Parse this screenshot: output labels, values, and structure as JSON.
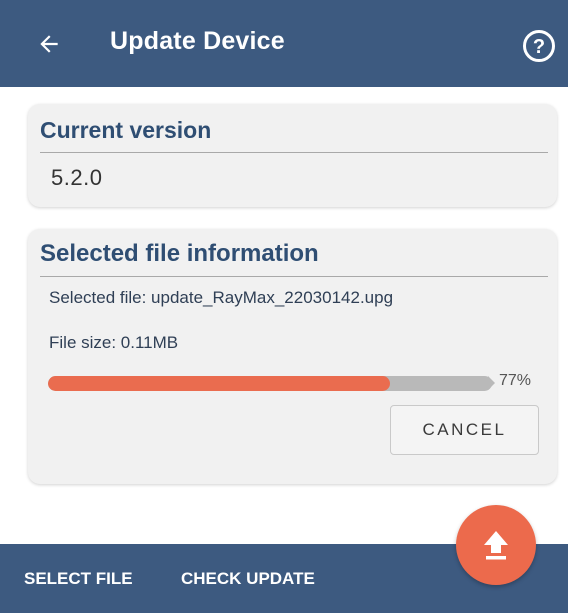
{
  "header": {
    "title": "Update Device",
    "back_icon": "arrow-left-icon",
    "help_icon": "help-circle-icon"
  },
  "version_card": {
    "title": "Current version",
    "value": "5.2.0"
  },
  "file_card": {
    "title": "Selected file information",
    "file_name_line": "Selected file: update_RayMax_22030142.upg",
    "file_size_line": "File size: 0.11MB",
    "progress": 0.77,
    "progress_label": "77%",
    "cancel_label": "CANCEL"
  },
  "bottom_bar": {
    "select_file_label": "SELECT FILE",
    "check_update_label": "CHECK UPDATE",
    "fab_icon": "upload-icon"
  },
  "colors": {
    "primary": "#3d5a80",
    "accent": "#ec6a4c",
    "title_text": "#2f4e73"
  }
}
